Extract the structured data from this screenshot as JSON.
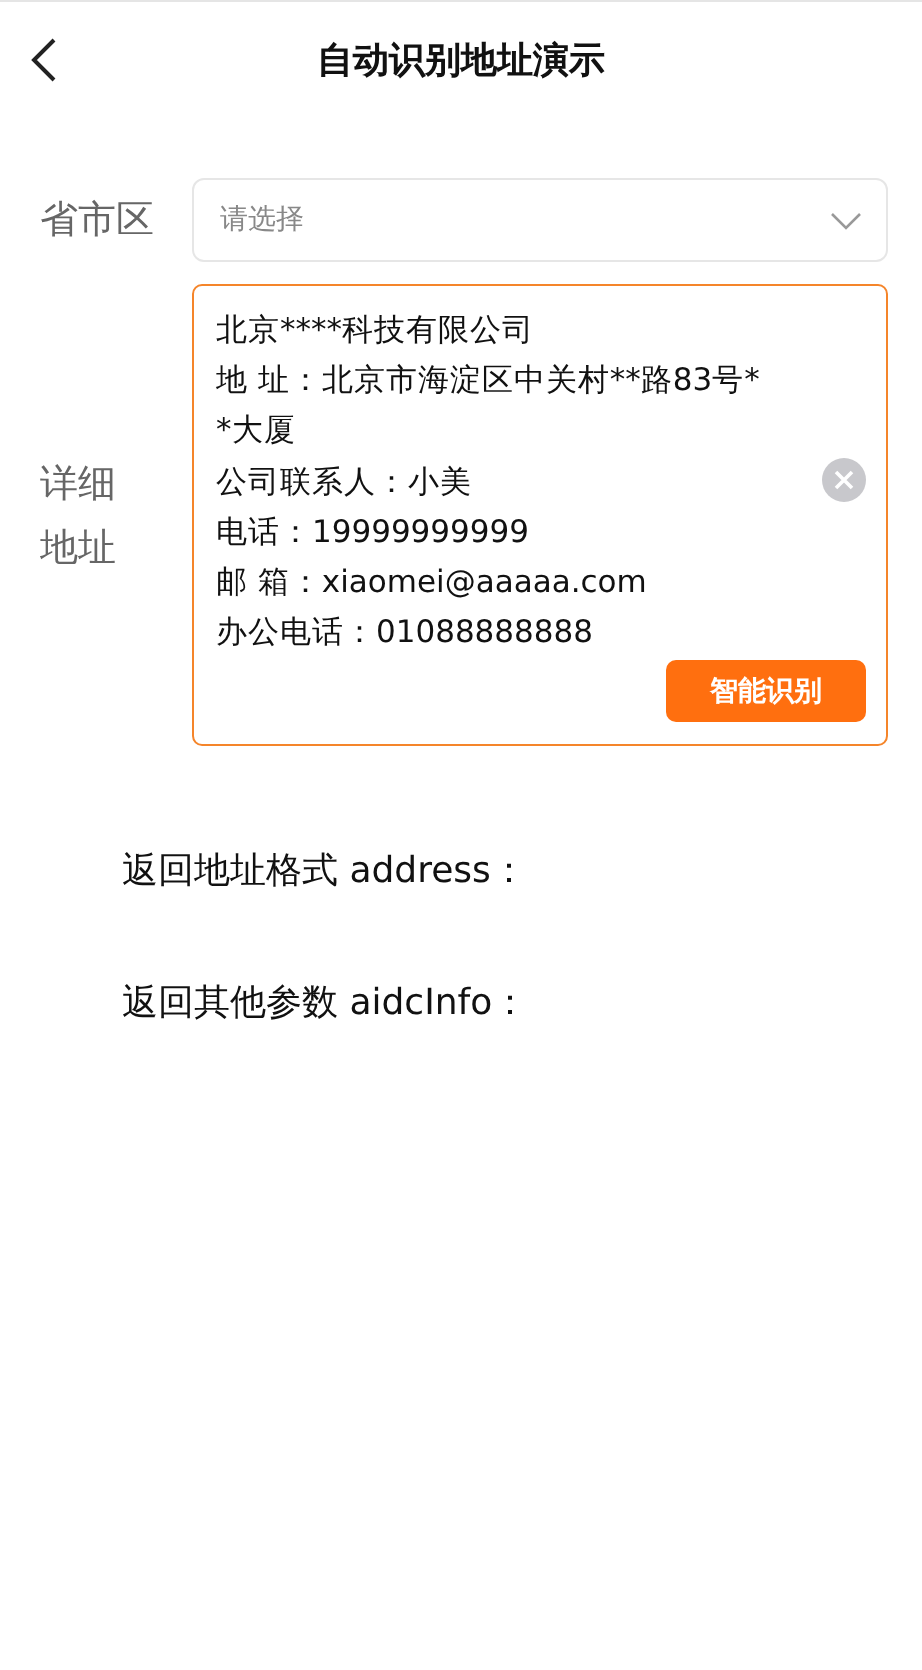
{
  "header": {
    "title": "自动识别地址演示"
  },
  "region": {
    "label": "省市区",
    "placeholder": "请选择"
  },
  "address": {
    "label": "详细地址",
    "lines": [
      "北京****科技有限公司",
      "地 址：北京市海淀区中关村**路83号*",
      "*大厦",
      "公司联系人：小美",
      "电话：19999999999",
      "邮 箱：xiaomei@aaaaa.com",
      "办公电话：01088888888"
    ],
    "button": "智能识别"
  },
  "results": [
    "返回地址格式 address：",
    "返回其他参数 aidcInfo："
  ]
}
